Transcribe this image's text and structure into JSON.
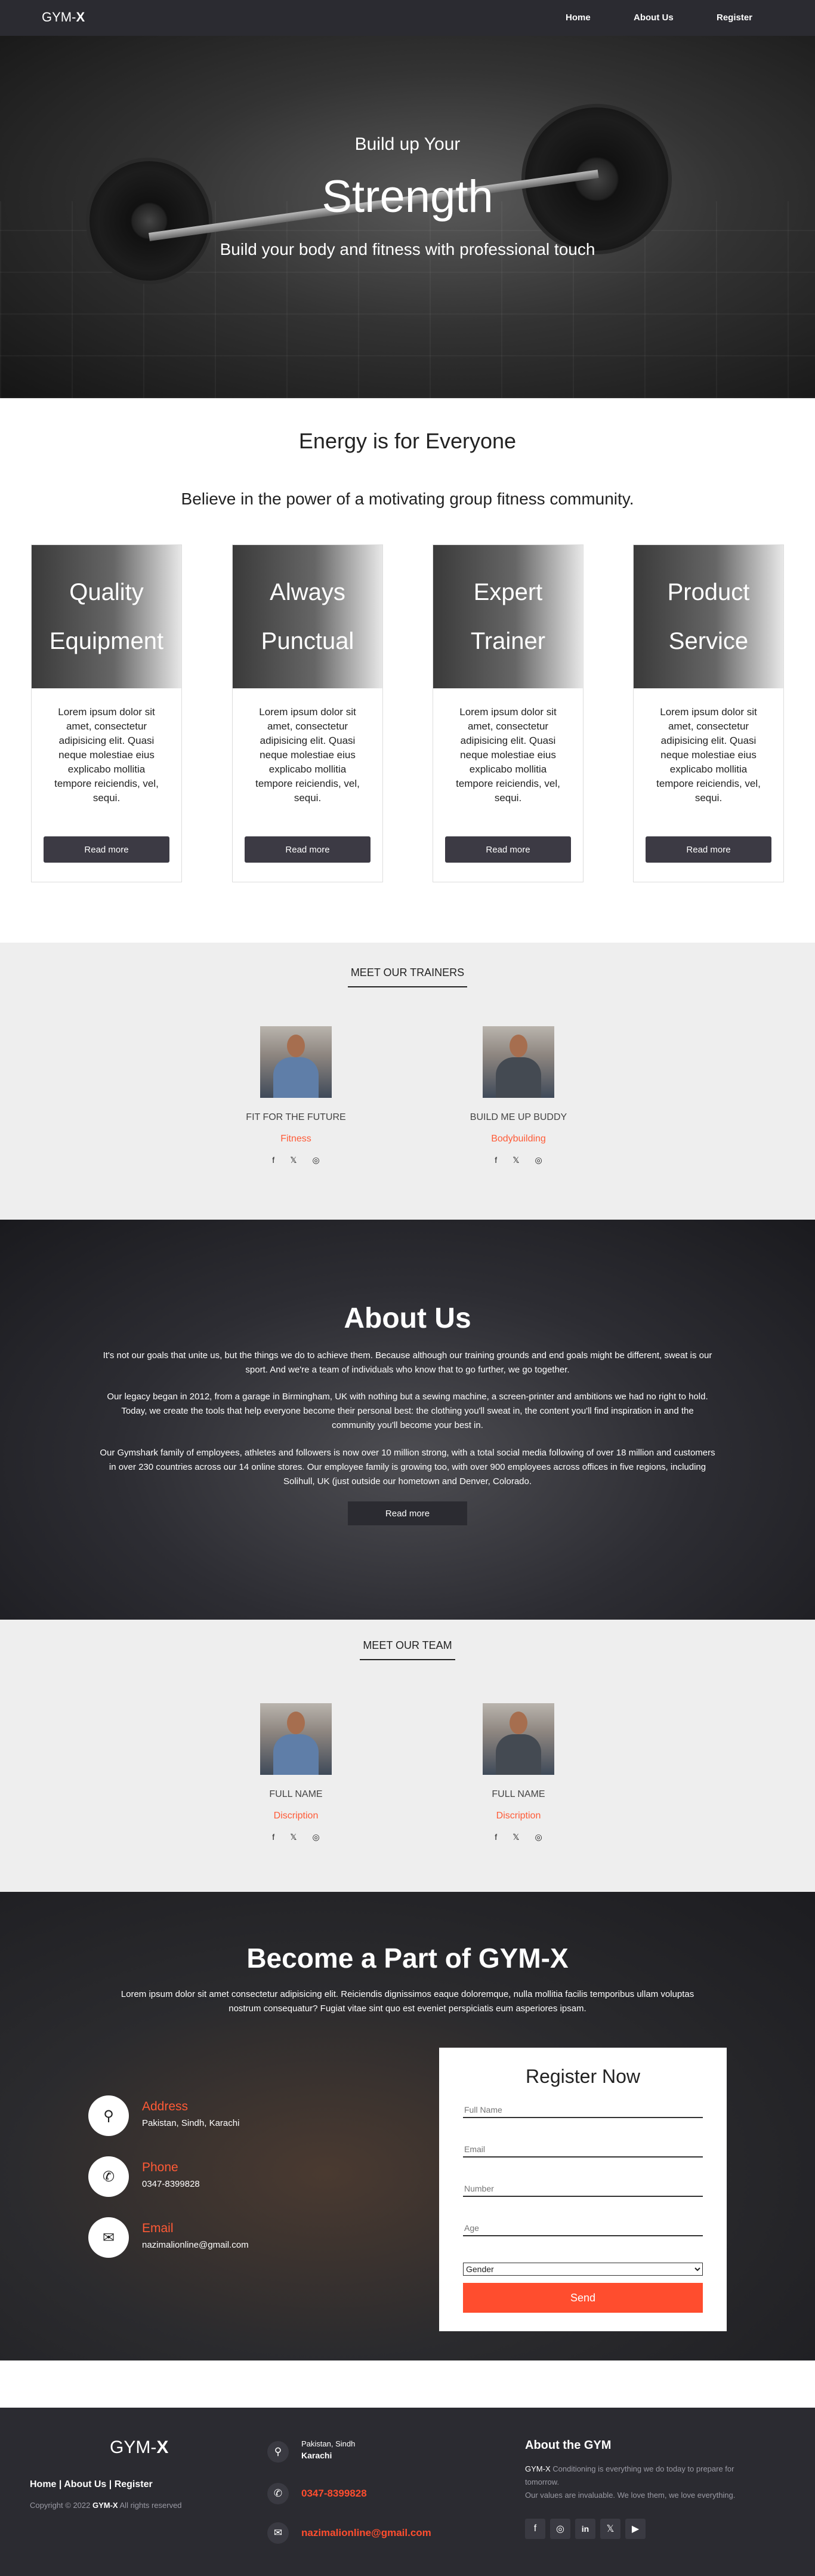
{
  "nav": {
    "brand": "GYM-",
    "brand_bold": "X",
    "links": [
      "Home",
      "About Us",
      "Register"
    ]
  },
  "hero": {
    "line1": "Build up Your",
    "line2": "Strength",
    "line3": "Build your body and fitness with professional touch"
  },
  "energy": {
    "title": "Energy is for Everyone",
    "subtitle": "Believe in the power of a motivating group fitness community.",
    "cards": [
      {
        "line1": "Quality",
        "line2": "Equipment",
        "text": "Lorem ipsum dolor sit amet, consectetur adipisicing elit. Quasi neque molestiae eius explicabo mollitia tempore reiciendis, vel, sequi.",
        "button": "Read more"
      },
      {
        "line1": "Always",
        "line2": "Punctual",
        "text": "Lorem ipsum dolor sit amet, consectetur adipisicing elit. Quasi neque molestiae eius explicabo mollitia tempore reiciendis, vel, sequi.",
        "button": "Read more"
      },
      {
        "line1": "Expert",
        "line2": "Trainer",
        "text": "Lorem ipsum dolor sit amet, consectetur adipisicing elit. Quasi neque molestiae eius explicabo mollitia tempore reiciendis, vel, sequi.",
        "button": "Read more"
      },
      {
        "line1": "Product",
        "line2": "Service",
        "text": "Lorem ipsum dolor sit amet, consectetur adipisicing elit. Quasi neque molestiae eius explicabo mollitia tempore reiciendis, vel, sequi.",
        "button": "Read more"
      }
    ]
  },
  "trainers": {
    "title": "MEET OUR TRAINERS",
    "people": [
      {
        "name": "FIT FOR THE FUTURE",
        "role": "Fitness"
      },
      {
        "name": "BUILD ME UP BUDDY",
        "role": "Bodybuilding"
      }
    ]
  },
  "about": {
    "title": "About Us",
    "p1": "It's not our goals that unite us, but the things we do to achieve them. Because although our training grounds and end goals might be different, sweat is our sport. And we're a team of individuals who know that to go further, we go together.",
    "p2": "Our legacy began in 2012, from a garage in Birmingham, UK with nothing but a sewing machine, a screen-printer and ambitions we had no right to hold. Today, we create the tools that help everyone become their personal best: the clothing you'll sweat in, the content you'll find inspiration in and the community you'll become your best in.",
    "p3": "Our Gymshark family of employees, athletes and followers is now over 10 million strong, with a total social media following of over 18 million and customers in over 230 countries across our 14 online stores. Our employee family is growing too, with over 900 employees across offices in five regions, including Solihull, UK (just outside our hometown and Denver, Colorado.",
    "button": "Read more"
  },
  "team": {
    "title": "MEET OUR TEAM",
    "people": [
      {
        "name": "FULL NAME",
        "role": "Discription"
      },
      {
        "name": "FULL NAME",
        "role": "Discription"
      }
    ]
  },
  "join": {
    "title": "Become a Part of GYM-X",
    "text": "Lorem ipsum dolor sit amet consectetur adipisicing elit. Reiciendis dignissimos eaque doloremque, nulla mollitia facilis temporibus ullam voluptas nostrum consequatur? Fugiat vitae sint quo est eveniet perspiciatis eum asperiores ipsam.",
    "contacts": [
      {
        "label": "Address",
        "value": "Pakistan, Sindh, Karachi",
        "icon": "map-marker-icon"
      },
      {
        "label": "Phone",
        "value": "0347-8399828",
        "icon": "phone-icon"
      },
      {
        "label": "Email",
        "value": "nazimalionline@gmail.com",
        "icon": "envelope-icon"
      }
    ],
    "form": {
      "title": "Register Now",
      "fields": [
        "Full Name",
        "Email",
        "Number",
        "Age"
      ],
      "select_value": "Gender",
      "submit": "Send"
    }
  },
  "footer": {
    "brand": "GYM-",
    "brand_bold": "X",
    "links": "Home | About Us | Register",
    "copy_prefix": "Copyright © 2022 ",
    "copy_brand": "GYM-X",
    "copy_suffix": " All rights reserved",
    "address_line1": "Pakistan, Sindh",
    "address_line2": "Karachi",
    "phone": "0347-8399828",
    "email": "nazimalionline@gmail.com",
    "about_title": "About the GYM",
    "about_brand": "GYM-X",
    "about_text1": " Conditioning is everything we do today to prepare for tomorrow.",
    "about_text2": "Our values are invaluable. We love them, we love everything.",
    "social_icons": [
      "facebook-icon",
      "instagram-icon",
      "linkedin-icon",
      "twitter-icon",
      "youtube-icon"
    ]
  }
}
